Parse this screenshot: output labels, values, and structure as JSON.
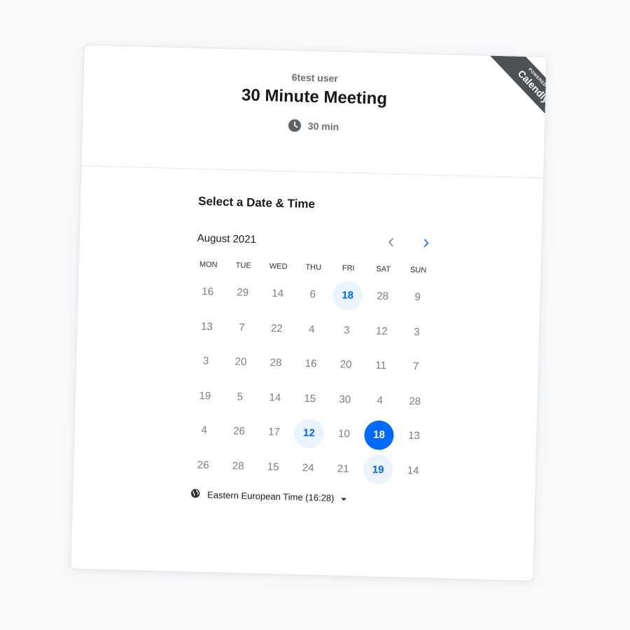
{
  "header": {
    "owner": "6test user",
    "title": "30 Minute Meeting",
    "duration": "30 min",
    "duration_icon": "clock-icon"
  },
  "ribbon": {
    "powered": "POWERED BY",
    "brand": "Calendly",
    "color": "#4d5055"
  },
  "scheduler": {
    "section_title": "Select a Date & Time",
    "month_label": "August 2021",
    "prev_icon": "chevron-left-icon",
    "next_icon": "chevron-right-icon",
    "weekdays": [
      "MON",
      "TUE",
      "WED",
      "THU",
      "FRI",
      "SAT",
      "SUN"
    ],
    "weeks": [
      [
        {
          "d": "16"
        },
        {
          "d": "29"
        },
        {
          "d": "14"
        },
        {
          "d": "6"
        },
        {
          "d": "18",
          "state": "available"
        },
        {
          "d": "28"
        },
        {
          "d": "9"
        }
      ],
      [
        {
          "d": "13"
        },
        {
          "d": "7"
        },
        {
          "d": "22"
        },
        {
          "d": "4"
        },
        {
          "d": "3"
        },
        {
          "d": "12"
        },
        {
          "d": "3"
        }
      ],
      [
        {
          "d": "3"
        },
        {
          "d": "20"
        },
        {
          "d": "28"
        },
        {
          "d": "16"
        },
        {
          "d": "20"
        },
        {
          "d": "11"
        },
        {
          "d": "7"
        }
      ],
      [
        {
          "d": "19"
        },
        {
          "d": "5"
        },
        {
          "d": "14"
        },
        {
          "d": "15"
        },
        {
          "d": "30"
        },
        {
          "d": "4"
        },
        {
          "d": "28"
        }
      ],
      [
        {
          "d": "4"
        },
        {
          "d": "26"
        },
        {
          "d": "17"
        },
        {
          "d": "12",
          "state": "available"
        },
        {
          "d": "10"
        },
        {
          "d": "18",
          "state": "selected"
        },
        {
          "d": "13"
        }
      ],
      [
        {
          "d": "26"
        },
        {
          "d": "28"
        },
        {
          "d": "15"
        },
        {
          "d": "24"
        },
        {
          "d": "21"
        },
        {
          "d": "19",
          "state": "available"
        },
        {
          "d": "14"
        }
      ]
    ],
    "timezone": "Eastern European Time (16:28)",
    "timezone_icon": "globe-icon"
  },
  "colors": {
    "accent": "#0069ff",
    "available_bg": "#eaf3fe",
    "muted_text": "#7a7d82"
  }
}
